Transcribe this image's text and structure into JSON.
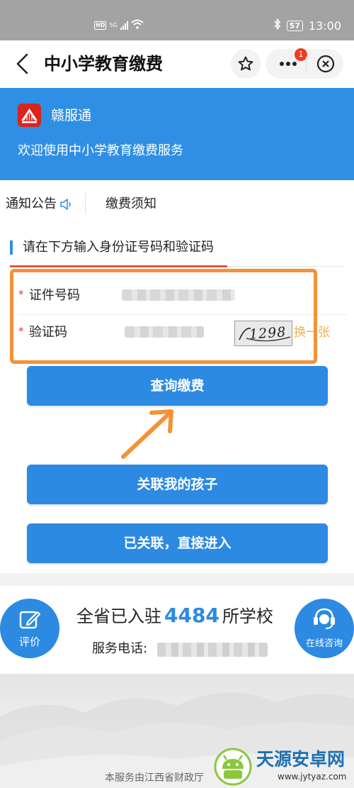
{
  "status_bar": {
    "hd": "HD",
    "net": "5G",
    "battery": "57",
    "time": "13:00"
  },
  "header": {
    "title": "中小学教育缴费",
    "notification_count": "1"
  },
  "banner": {
    "brand": "赣服通",
    "welcome": "欢迎使用中小学教育缴费服务"
  },
  "tabs": {
    "notice": "通知公告",
    "instructions": "缴费须知"
  },
  "form": {
    "heading": "请在下方输入身份证号码和验证码",
    "required_mark": "*",
    "id_label": "证件号码",
    "code_label": "验证码",
    "captcha_text": "1298",
    "refresh_label": "换一张"
  },
  "buttons": {
    "query": "查询缴费",
    "link_child": "关联我的孩子",
    "linked_enter": "已关联，直接进入"
  },
  "stats": {
    "prefix": "全省已入驻",
    "count": "4484",
    "suffix": "所学校",
    "phone_label": "服务电话:",
    "rate_label": "评价",
    "consult_label": "在线咨询"
  },
  "footer": {
    "text": "本服务由江西省财政厅"
  },
  "watermark": {
    "title": "天源安卓网",
    "url": "www.jytyaz.com"
  },
  "colors": {
    "primary": "#2c8ae2",
    "highlight": "#f39237",
    "required": "#e23b2a"
  }
}
